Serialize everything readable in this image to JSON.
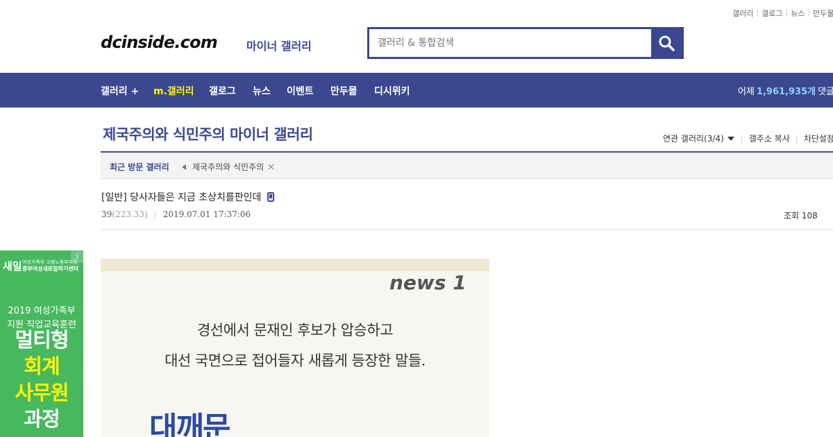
{
  "top_links": [
    "갤러리",
    "갤로그",
    "뉴스",
    "만두몰"
  ],
  "logo": {
    "text": "dcinside.com",
    "sub": "마이너 갤러리"
  },
  "search": {
    "placeholder": "갤러리 & 통합검색",
    "icon": "search-icon"
  },
  "nav": {
    "items": [
      "갤러리 +",
      "m.갤러리",
      "갤로그",
      "뉴스",
      "이벤트",
      "만두몰",
      "디시위키"
    ],
    "active_index": 1,
    "visitors_prefix": "어제",
    "visitors_count": "1,961,935개",
    "visitors_suffix": "댓글"
  },
  "gallery": {
    "title": "제국주의와 식민주의 마이너 갤러리",
    "tools": [
      "연관 갤러리(3/4)",
      "갤주소 복사",
      "차단설정"
    ]
  },
  "recent": {
    "label": "최근 방문 갤러리",
    "item": "제국주의와 식민주의"
  },
  "post": {
    "title": "[일반] 당사자들은 지금 초상치를판인데",
    "author": "39",
    "ip": "(223.33)",
    "date": "2019.07.01 17:37:06",
    "views": "조회 108"
  },
  "ad": {
    "logo": "새일",
    "org_line1": "여성가족부·고용노동부지정",
    "org_line2": "중부여성새로일하기센터",
    "line1": "2019 여성가족부",
    "line2": "지원 직업교육훈련",
    "big": [
      "멀티형",
      "회계",
      "사무원",
      "과정"
    ],
    "info": "i"
  },
  "article_image": {
    "brand": "news 1",
    "line1": "경선에서 문재인 후보가 압승하고",
    "line2": "대선 국면으로 접어들자 새롭게 등장한 말들.",
    "big": "대깨문"
  },
  "colors": {
    "brand": "#3b4890",
    "active_nav": "#fff200",
    "ad_green": "#47b85e"
  }
}
